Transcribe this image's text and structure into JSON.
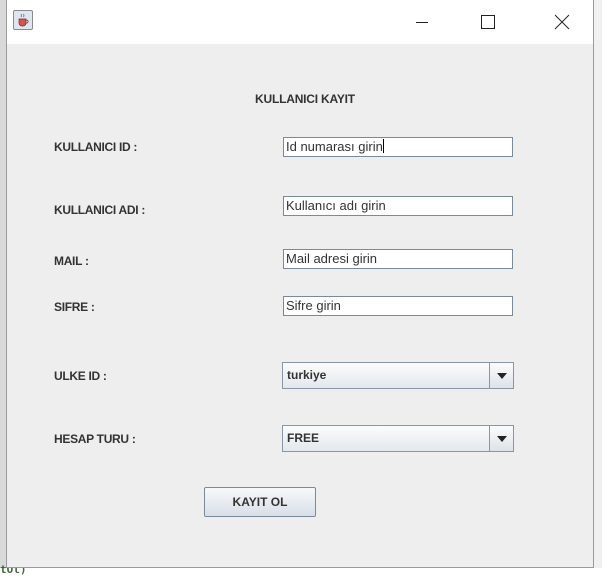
{
  "window": {
    "title_icon": "java-coffee-icon",
    "controls": [
      "minimize-icon",
      "maximize-icon",
      "close-icon"
    ]
  },
  "form": {
    "heading": "KULLANICI KAYIT",
    "fields": [
      {
        "label": "KULLANICI ID :",
        "value": "Id numarası girin"
      },
      {
        "label": "KULLANICI ADI :",
        "value": "Kullanıcı adı girin"
      },
      {
        "label": "MAIL :",
        "value": "Mail adresi girin"
      },
      {
        "label": "SIFRE :",
        "value": "Sifre girin"
      }
    ],
    "country": {
      "label": "ULKE ID :",
      "selected": "turkiye"
    },
    "account_type": {
      "label": "HESAP TURU :",
      "selected": "FREE"
    },
    "submit_label": "KAYIT OL"
  },
  "background": {
    "snippet": "tOl)"
  }
}
